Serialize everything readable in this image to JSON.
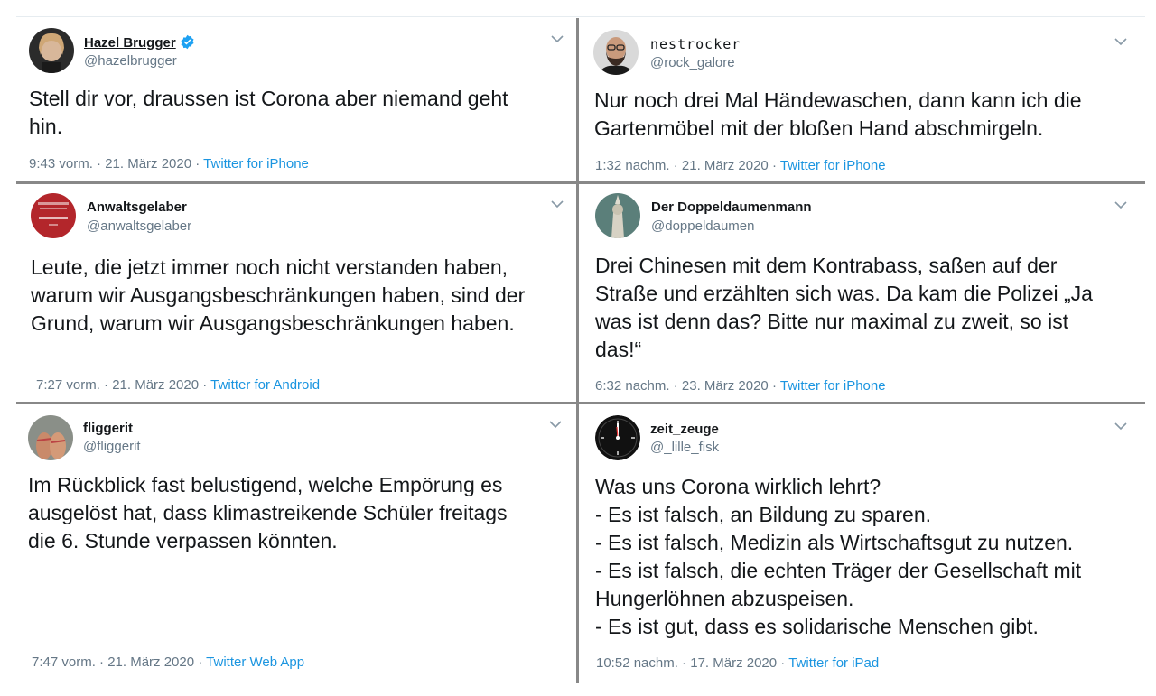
{
  "tweets": [
    {
      "display_name": "Hazel Brugger",
      "handle": "@hazelbrugger",
      "text": "Stell dir vor, draussen ist Corona aber niemand geht\nhin.",
      "time": "9:43 vorm. · 21. März 2020 ·",
      "source": "Twitter for iPhone"
    },
    {
      "display_name": "nestrocker",
      "handle": "@rock_galore",
      "text": "Nur noch drei Mal Händewaschen, dann kann ich die\nGartenmöbel mit der bloßen Hand abschmirgeln.",
      "time": "1:32 nachm. · 21. März 2020 ·",
      "source": "Twitter for iPhone"
    },
    {
      "display_name": "Anwaltsgelaber",
      "handle": "@anwaltsgelaber",
      "text": "Leute, die jetzt immer noch nicht verstanden haben,\nwarum wir Ausgangsbeschränkungen haben, sind der\nGrund, warum wir Ausgangsbeschränkungen haben.",
      "time": "7:27 vorm. · 21. März 2020 ·",
      "source": "Twitter for Android"
    },
    {
      "display_name": "Der Doppeldaumenmann",
      "handle": "@doppeldaumen",
      "text": "Drei Chinesen mit dem Kontrabass, saßen auf der\nStraße und erzählten sich was. Da kam die Polizei „Ja\nwas ist denn das? Bitte nur maximal zu zweit, so ist\ndas!“",
      "time": "6:32 nachm. · 23. März 2020 ·",
      "source": "Twitter for iPhone"
    },
    {
      "display_name": "fliggerit",
      "handle": "@fliggerit",
      "text": "Im Rückblick fast belustigend, welche Empörung es\nausgelöst hat, dass klimastreikende Schüler freitags\ndie 6. Stunde verpassen könnten.",
      "time": "7:47 vorm. · 21. März 2020 ·",
      "source": "Twitter Web App"
    },
    {
      "display_name": "zeit_zeuge",
      "handle": "@_lille_fisk",
      "text": "Was uns Corona wirklich lehrt?\n- Es ist falsch, an Bildung zu sparen.\n- Es ist falsch, Medizin als Wirtschaftsgut zu nutzen.\n- Es ist falsch, die echten Träger der Gesellschaft mit\nHungerlöhnen abzuspeisen.\n- Es ist gut, dass es solidarische Menschen gibt.",
      "time": "10:52 nachm. · 17. März 2020 ·",
      "source": "Twitter for iPad"
    }
  ],
  "icons": {
    "verified": "verified-badge-icon",
    "menu": "chevron-down-icon"
  },
  "colors": {
    "link": "#1b95e0",
    "muted": "#657786",
    "text": "#14171a",
    "verified": "#1da1f2"
  }
}
